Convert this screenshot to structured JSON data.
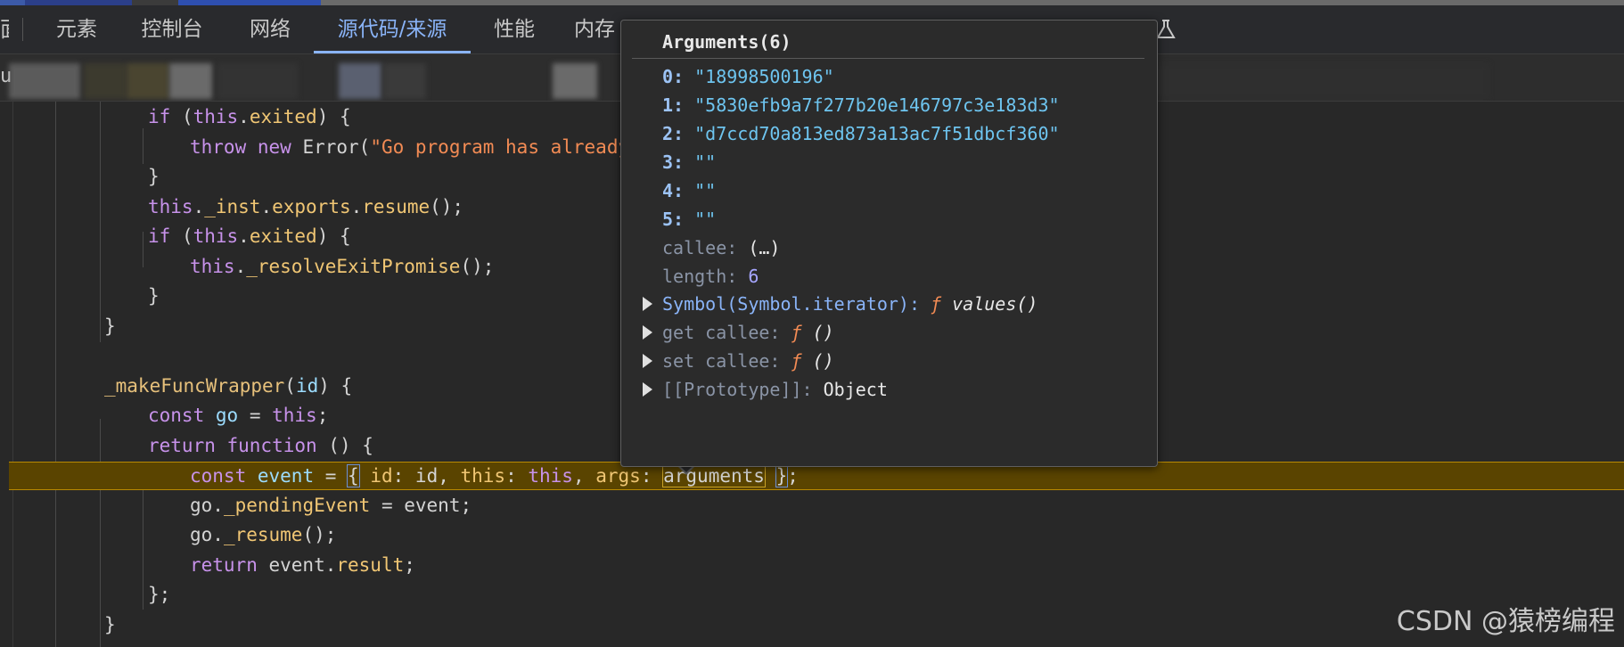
{
  "tabs": {
    "edge_glyph": "面",
    "items": [
      {
        "label": "元素",
        "active": false
      },
      {
        "label": "控制台",
        "active": false
      },
      {
        "label": "网络",
        "active": false
      },
      {
        "label": "源代码/来源",
        "active": true
      },
      {
        "label": "性能",
        "active": false
      },
      {
        "label": "内存",
        "active": false
      }
    ]
  },
  "file_bar": {
    "left_fragment": "u"
  },
  "code": {
    "lines": [
      [
        {
          "t": "if",
          "c": "kw"
        },
        {
          "t": " (",
          "c": "plain"
        },
        {
          "t": "this",
          "c": "kw"
        },
        {
          "t": ".",
          "c": "plain"
        },
        {
          "t": "exited",
          "c": "prop"
        },
        {
          "t": ") {",
          "c": "plain"
        }
      ],
      [
        {
          "t": "throw new",
          "c": "kw"
        },
        {
          "t": " Error(",
          "c": "plain"
        },
        {
          "t": "\"Go program has already e",
          "c": "str"
        }
      ],
      [
        {
          "t": "}",
          "c": "plain"
        }
      ],
      [
        {
          "t": "this",
          "c": "kw"
        },
        {
          "t": ".",
          "c": "plain"
        },
        {
          "t": "_inst",
          "c": "prop"
        },
        {
          "t": ".",
          "c": "plain"
        },
        {
          "t": "exports",
          "c": "prop"
        },
        {
          "t": ".",
          "c": "plain"
        },
        {
          "t": "resume",
          "c": "prop"
        },
        {
          "t": "();",
          "c": "plain"
        }
      ],
      [
        {
          "t": "if",
          "c": "kw"
        },
        {
          "t": " (",
          "c": "plain"
        },
        {
          "t": "this",
          "c": "kw"
        },
        {
          "t": ".",
          "c": "plain"
        },
        {
          "t": "exited",
          "c": "prop"
        },
        {
          "t": ") {",
          "c": "plain"
        }
      ],
      [
        {
          "t": "this",
          "c": "kw"
        },
        {
          "t": ".",
          "c": "plain"
        },
        {
          "t": "_resolveExitPromise",
          "c": "prop"
        },
        {
          "t": "();",
          "c": "plain"
        }
      ],
      [
        {
          "t": "}",
          "c": "plain"
        }
      ],
      [
        {
          "t": "}",
          "c": "plain"
        }
      ],
      [],
      [
        {
          "t": "_makeFuncWrapper",
          "c": "fn"
        },
        {
          "t": "(",
          "c": "plain"
        },
        {
          "t": "id",
          "c": "var"
        },
        {
          "t": ") {",
          "c": "plain"
        }
      ],
      [
        {
          "t": "const",
          "c": "kw"
        },
        {
          "t": " ",
          "c": "plain"
        },
        {
          "t": "go",
          "c": "var"
        },
        {
          "t": " = ",
          "c": "plain"
        },
        {
          "t": "this",
          "c": "kw"
        },
        {
          "t": ";",
          "c": "plain"
        }
      ],
      [
        {
          "t": "return function",
          "c": "kw"
        },
        {
          "t": " () {",
          "c": "plain"
        }
      ],
      [
        {
          "t": "const",
          "c": "kw"
        },
        {
          "t": " ",
          "c": "plain"
        },
        {
          "t": "event",
          "c": "var"
        },
        {
          "t": " = ",
          "c": "plain"
        },
        {
          "t": "{",
          "c": "plain",
          "box": "blue"
        },
        {
          "t": " ",
          "c": "plain"
        },
        {
          "t": "id",
          "c": "prop"
        },
        {
          "t": ": id, ",
          "c": "plain"
        },
        {
          "t": "this",
          "c": "prop"
        },
        {
          "t": ": ",
          "c": "plain"
        },
        {
          "t": "this",
          "c": "kw"
        },
        {
          "t": ", ",
          "c": "plain"
        },
        {
          "t": "args",
          "c": "prop"
        },
        {
          "t": ": ",
          "c": "plain"
        },
        {
          "t": "arguments",
          "c": "plain",
          "box": "gold"
        },
        {
          "t": " ",
          "c": "plain"
        },
        {
          "t": "}",
          "c": "plain",
          "box": "blue"
        },
        {
          "t": ";",
          "c": "plain"
        }
      ],
      [
        {
          "t": "go.",
          "c": "plain"
        },
        {
          "t": "_pendingEvent",
          "c": "prop"
        },
        {
          "t": " = event;",
          "c": "plain"
        }
      ],
      [
        {
          "t": "go.",
          "c": "plain"
        },
        {
          "t": "_resume",
          "c": "prop"
        },
        {
          "t": "();",
          "c": "plain"
        }
      ],
      [
        {
          "t": "return",
          "c": "kw"
        },
        {
          "t": " event.",
          "c": "plain"
        },
        {
          "t": "result",
          "c": "prop"
        },
        {
          "t": ";",
          "c": "plain"
        }
      ],
      [
        {
          "t": "};",
          "c": "plain"
        }
      ],
      [
        {
          "t": "}",
          "c": "plain"
        }
      ]
    ]
  },
  "popover": {
    "title": "Arguments(6)",
    "entries": [
      {
        "key": "0",
        "value": "\"18998500196\""
      },
      {
        "key": "1",
        "value": "\"5830efb9a7f277b20e146797c3e183d3\""
      },
      {
        "key": "2",
        "value": "\"d7ccd70a813ed873a13ac7f51dbcf360\""
      },
      {
        "key": "3",
        "value": "\"\""
      },
      {
        "key": "4",
        "value": "\"\""
      },
      {
        "key": "5",
        "value": "\"\""
      }
    ],
    "callee": {
      "key": "callee",
      "value": "(…)"
    },
    "length": {
      "key": "length",
      "value": "6"
    },
    "expandables": [
      {
        "key": "Symbol(Symbol.iterator)",
        "f": "ƒ",
        "fn": "values()"
      },
      {
        "key": "get callee",
        "f": "ƒ",
        "fn": "()"
      },
      {
        "key": "set callee",
        "f": "ƒ",
        "fn": "()"
      },
      {
        "key": "[[Prototype]]",
        "value": "Object"
      }
    ]
  },
  "watermark": "CSDN @猿榜编程"
}
